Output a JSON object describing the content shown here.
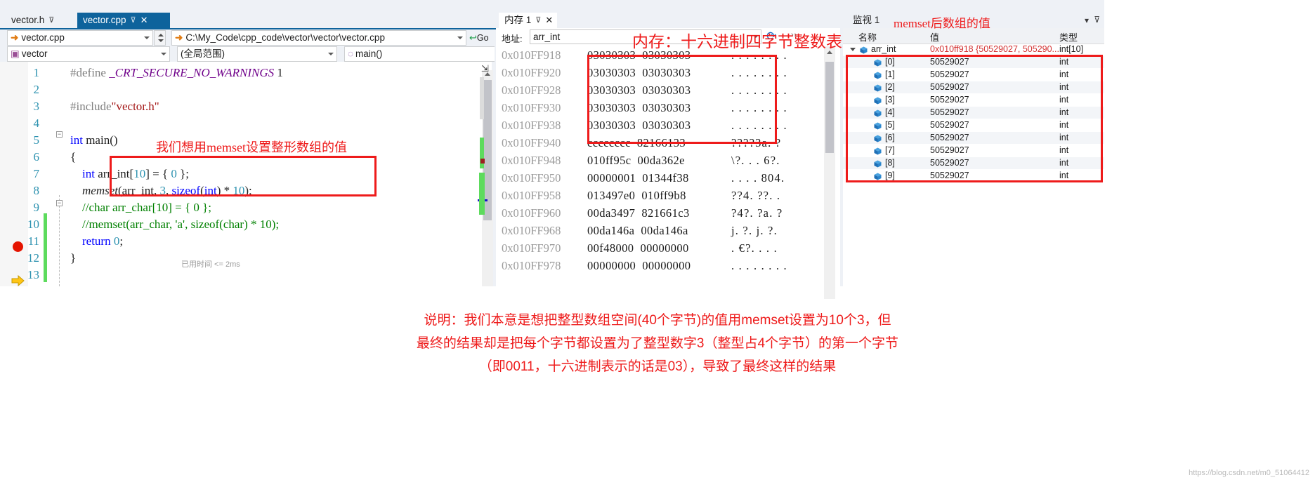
{
  "editor": {
    "tabs": [
      {
        "label": "vector.h",
        "active": false,
        "pin": "⊽",
        "close": ""
      },
      {
        "label": "vector.cpp",
        "active": true,
        "pin": "⊽",
        "close": "✕"
      }
    ],
    "nav": {
      "file_combo": "vector.cpp",
      "path_combo": "C:\\My_Code\\cpp_code\\vector\\vector\\vector.cpp",
      "go_label": "Go",
      "project_combo": "vector",
      "scope_combo": "(全局范围)",
      "member_combo": "main()"
    },
    "lines": [
      {
        "n": "1",
        "html": "<span class=\"pre\">#define</span> <span class=\"mac\">_CRT_SECURE_NO_WARNINGS</span> 1"
      },
      {
        "n": "2",
        "html": ""
      },
      {
        "n": "3",
        "html": "<span class=\"pre\">#include</span><span class=\"s\">\"vector.h\"</span>"
      },
      {
        "n": "4",
        "html": ""
      },
      {
        "n": "5",
        "html": "<span class=\"k\">int</span> main()"
      },
      {
        "n": "6",
        "html": "{"
      },
      {
        "n": "7",
        "html": "    <span class=\"k\">int</span> arr_int[<span class=\"m\">10</span>] = { <span class=\"m\">0</span> };"
      },
      {
        "n": "8",
        "html": "    <span class=\"fn\">memset</span>(arr_int, <span class=\"m\">3</span>, <span class=\"k\">sizeof</span>(<span class=\"k\">int</span>) * <span class=\"m\">10</span>);"
      },
      {
        "n": "9",
        "html": "    <span class=\"c\">//char arr_char[10] = { 0 };</span>"
      },
      {
        "n": "10",
        "html": "    <span class=\"c\">//memset(arr_char, 'a', sizeof(char) * 10);</span>"
      },
      {
        "n": "11",
        "html": "    <span class=\"k\">return</span> <span class=\"m\">0</span>;"
      },
      {
        "n": "12",
        "html": "}"
      },
      {
        "n": "13",
        "html": ""
      }
    ],
    "timing_hint": "已用时间 <= 2ms",
    "annotation": "我们想用memset设置整形数组的值"
  },
  "memory": {
    "tab_label": "内存 1",
    "pin": "⊽",
    "close": "✕",
    "address_label": "地址:",
    "address_value": "arr_int",
    "refresh_icon": "refresh-icon",
    "annotation": "内存：十六进制四字节整数表示",
    "rows": [
      {
        "addr": "0x010FF918",
        "hex": "03030303  03030303",
        "ascii": ". . . . . . . ."
      },
      {
        "addr": "0x010FF920",
        "hex": "03030303  03030303",
        "ascii": ". . . . . . . ."
      },
      {
        "addr": "0x010FF928",
        "hex": "03030303  03030303",
        "ascii": ". . . . . . . ."
      },
      {
        "addr": "0x010FF930",
        "hex": "03030303  03030303",
        "ascii": ". . . . . . . ."
      },
      {
        "addr": "0x010FF938",
        "hex": "03030303  03030303",
        "ascii": ". . . . . . . ."
      },
      {
        "addr": "0x010FF940",
        "hex": "cccccccc  82166133",
        "ascii": "????3a. ?"
      },
      {
        "addr": "0x010FF948",
        "hex": "010ff95c  00da362e",
        "ascii": "\\?. . . 6?."
      },
      {
        "addr": "0x010FF950",
        "hex": "00000001  01344f38",
        "ascii": ". . . . 804."
      },
      {
        "addr": "0x010FF958",
        "hex": "013497e0  010ff9b8",
        "ascii": "??4. ??. ."
      },
      {
        "addr": "0x010FF960",
        "hex": "00da3497  821661c3",
        "ascii": "?4?. ?a. ?"
      },
      {
        "addr": "0x010FF968",
        "hex": "00da146a  00da146a",
        "ascii": "j. ?. j. ?."
      },
      {
        "addr": "0x010FF970",
        "hex": "00f48000  00000000",
        "ascii": ". €?. . . ."
      },
      {
        "addr": "0x010FF978",
        "hex": "00000000  00000000",
        "ascii": ". . . . . . . ."
      }
    ]
  },
  "watch": {
    "tab_label": "监视 1",
    "annotation": "memset后数组的值",
    "columns": {
      "name": "名称",
      "value": "值",
      "type": "类型"
    },
    "rows": [
      {
        "name": "arr_int",
        "value": "0x010ff918 {50529027, 505290...",
        "type": "int[10]",
        "depth": 0,
        "expanded": true,
        "changed": true
      },
      {
        "name": "[0]",
        "value": "50529027",
        "type": "int",
        "depth": 1,
        "expanded": false,
        "changed": false
      },
      {
        "name": "[1]",
        "value": "50529027",
        "type": "int",
        "depth": 1,
        "expanded": false,
        "changed": false
      },
      {
        "name": "[2]",
        "value": "50529027",
        "type": "int",
        "depth": 1,
        "expanded": false,
        "changed": false
      },
      {
        "name": "[3]",
        "value": "50529027",
        "type": "int",
        "depth": 1,
        "expanded": false,
        "changed": false
      },
      {
        "name": "[4]",
        "value": "50529027",
        "type": "int",
        "depth": 1,
        "expanded": false,
        "changed": false
      },
      {
        "name": "[5]",
        "value": "50529027",
        "type": "int",
        "depth": 1,
        "expanded": false,
        "changed": false
      },
      {
        "name": "[6]",
        "value": "50529027",
        "type": "int",
        "depth": 1,
        "expanded": false,
        "changed": false
      },
      {
        "name": "[7]",
        "value": "50529027",
        "type": "int",
        "depth": 1,
        "expanded": false,
        "changed": false
      },
      {
        "name": "[8]",
        "value": "50529027",
        "type": "int",
        "depth": 1,
        "expanded": false,
        "changed": false
      },
      {
        "name": "[9]",
        "value": "50529027",
        "type": "int",
        "depth": 1,
        "expanded": false,
        "changed": false
      }
    ]
  },
  "caption": {
    "line1": "说明：我们本意是想把整型数组空间(40个字节)的值用memset设置为10个3，但",
    "line2": "最终的结果却是把每个字节都设置为了整型数字3（整型占4个字节）的第一个字节",
    "line3": "（即0011，十六进制表示的话是03），导致了最终这样的结果"
  },
  "watermark": "https://blog.csdn.net/m0_51064412",
  "colors": {
    "accent": "#0e639c",
    "annotation_red": "#ee1b1b",
    "changed_value": "#d33131",
    "keyword_blue": "#0000ff",
    "comment_green": "#008000",
    "string_red": "#a31515"
  }
}
